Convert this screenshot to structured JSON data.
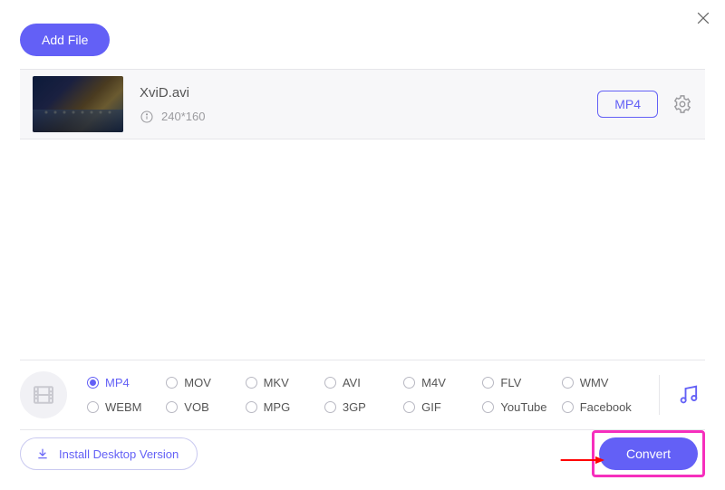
{
  "header": {
    "add_file_label": "Add File"
  },
  "file": {
    "name": "XviD.avi",
    "resolution": "240*160",
    "output_format": "MP4"
  },
  "formats": {
    "row1": [
      "MP4",
      "MOV",
      "MKV",
      "AVI",
      "M4V",
      "FLV",
      "WMV"
    ],
    "row2": [
      "WEBM",
      "VOB",
      "MPG",
      "3GP",
      "GIF",
      "YouTube",
      "Facebook"
    ],
    "selected": "MP4"
  },
  "footer": {
    "install_label": "Install Desktop Version",
    "convert_label": "Convert"
  }
}
